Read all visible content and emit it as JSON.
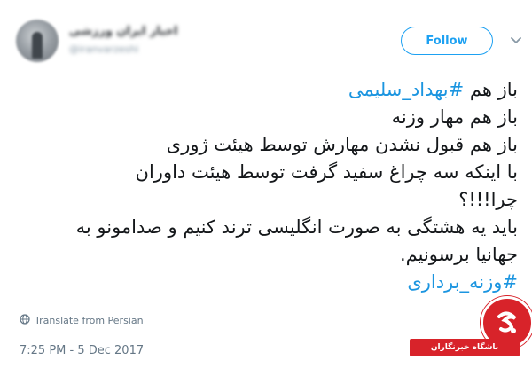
{
  "user": {
    "display_name": "اخبار ایران ورزشی",
    "handle": "@iranvarzeshi"
  },
  "follow_label": "Follow",
  "tweet": {
    "lines": [
      {
        "prefix": "باز هم ",
        "hashtag": "#بهداد_سلیمی",
        "text": ""
      },
      {
        "text": "باز هم مهار وزنه"
      },
      {
        "text": "باز هم قبول نشدن مهارش توسط هیئت ژوری"
      },
      {
        "text": "با اینکه سه چراغ سفید گرفت توسط هیئت داوران"
      },
      {
        "text": "چرا!!!؟"
      },
      {
        "text": "باید یه هشتگی به صورت انگلیسی ترند کنیم و صدامونو به"
      },
      {
        "text": "جهانیا برسونیم."
      },
      {
        "hashtag": "#وزنه_برداری"
      }
    ]
  },
  "translate_label": "Translate from Persian",
  "timestamp": "7:25 PM - 5 Dec 2017",
  "watermark": {
    "text": "باشگاه خبرنگاران",
    "brand_color": "#d8232a"
  },
  "colors": {
    "link": "#1b95e0",
    "follow_border": "#1da1f2",
    "meta": "#657786"
  },
  "icons": {
    "globe": "globe-icon",
    "caret": "chevron-down-icon"
  }
}
